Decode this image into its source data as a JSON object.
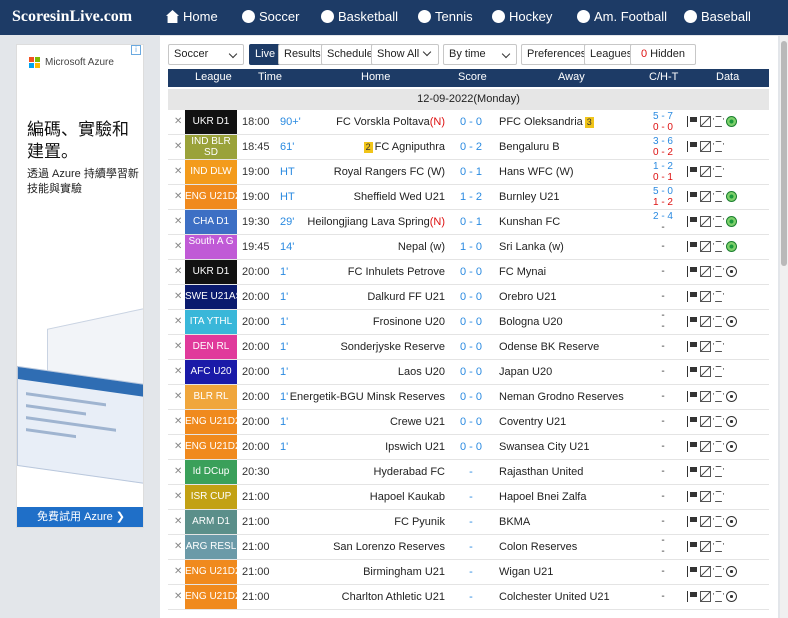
{
  "logo": "ScoresinLive.com",
  "nav": [
    {
      "label": "Home",
      "icon": "house-icon"
    },
    {
      "label": "Soccer",
      "icon": "soccer-ball-icon"
    },
    {
      "label": "Basketball",
      "icon": "basketball-icon"
    },
    {
      "label": "Tennis",
      "icon": "tennis-ball-icon"
    },
    {
      "label": "Hockey",
      "icon": "hockey-icon"
    },
    {
      "label": "Am. Football",
      "icon": "american-football-icon"
    },
    {
      "label": "Baseball",
      "icon": "baseball-icon"
    }
  ],
  "ad": {
    "brand": "Microsoft Azure",
    "headline": "編碼、實驗和建置。",
    "sub": "透過 Azure 持續學習新技能與實驗",
    "cta": "免費試用 Azure ❯",
    "info_icon": "ad-choices-icon"
  },
  "toolbar": {
    "sport": "Soccer",
    "live": "Live",
    "results": "Results",
    "schedule": "Schedule",
    "show_all": "Show All",
    "by_time": "By time",
    "preferences": "Preferences",
    "leagues": "Leagues",
    "hidden_count": "0",
    "hidden_label": "Hidden"
  },
  "columns": {
    "league": "League",
    "time": "Time",
    "home": "Home",
    "score": "Score",
    "away": "Away",
    "cht": "C/H-T",
    "data": "Data"
  },
  "date": "12-09-2022(Monday)",
  "colors": {
    "nav": "#1d3b66",
    "live_blue": "#2a8ae0",
    "red": "#d11111",
    "card_yellow": "#f0c419"
  },
  "matches": [
    {
      "league": "UKR D1",
      "color": "#111111",
      "time": "18:00",
      "status": "90+'",
      "home": "FC Vorskla Poltava",
      "home_tag": "(N)",
      "home_card": "",
      "score": "0 - 0",
      "away": "PFC Oleksandria",
      "away_card": "3",
      "cht": [
        "5 - 7",
        "0 - 0"
      ],
      "ball": "green"
    },
    {
      "league": "IND BLR SD",
      "color": "#9aa23a",
      "time": "18:45",
      "status": "61'",
      "home": "FC Agniputhra",
      "home_tag": "",
      "home_card": "2",
      "score": "0 - 2",
      "away": "Bengaluru B",
      "away_card": "",
      "cht": [
        "3 - 6",
        "0 - 2"
      ],
      "ball": "none"
    },
    {
      "league": "IND DLW",
      "color": "#f39b1c",
      "time": "19:00",
      "status": "HT",
      "home": "Royal Rangers FC (W)",
      "home_tag": "",
      "home_card": "",
      "score": "0 - 1",
      "away": "Hans WFC (W)",
      "away_card": "",
      "cht": [
        "1 - 2",
        "0 - 1"
      ],
      "ball": "none"
    },
    {
      "league": "ENG U21D2",
      "color": "#f08a1e",
      "time": "19:00",
      "status": "HT",
      "home": "Sheffield Wed U21",
      "home_tag": "",
      "home_card": "",
      "score": "1 - 2",
      "away": "Burnley U21",
      "away_card": "",
      "cht": [
        "5 - 0",
        "1 - 2"
      ],
      "ball": "green"
    },
    {
      "league": "CHA D1",
      "color": "#3d6fc4",
      "time": "19:30",
      "status": "29'",
      "home": "Heilongjiang Lava Spring",
      "home_tag": "(N)",
      "home_card": "",
      "score": "0 - 1",
      "away": "Kunshan FC",
      "away_card": "",
      "cht": [
        "2 - 4",
        "-"
      ],
      "ball": "green"
    },
    {
      "league": "South A G",
      "color": "#c05ad6",
      "time": "19:45",
      "status": "14'",
      "home": "Nepal (w)",
      "home_tag": "",
      "home_card": "",
      "score": "1 - 0",
      "away": "Sri Lanka (w)",
      "away_card": "",
      "cht": [
        "-"
      ],
      "ball": "green"
    },
    {
      "league": "UKR D1",
      "color": "#111111",
      "time": "20:00",
      "status": "1'",
      "home": "FC Inhulets Petrove",
      "home_tag": "",
      "home_card": "",
      "score": "0 - 0",
      "away": "FC Mynai",
      "away_card": "",
      "cht": [
        "-"
      ],
      "ball": "plain"
    },
    {
      "league": "SWE U21AS",
      "color": "#0a1a6e",
      "time": "20:00",
      "status": "1'",
      "home": "Dalkurd FF U21",
      "home_tag": "",
      "home_card": "",
      "score": "0 - 0",
      "away": "Orebro U21",
      "away_card": "",
      "cht": [
        "-"
      ],
      "ball": "none"
    },
    {
      "league": "ITA YTHL",
      "color": "#39b7d9",
      "time": "20:00",
      "status": "1'",
      "home": "Frosinone U20",
      "home_tag": "",
      "home_card": "",
      "score": "0 - 0",
      "away": "Bologna U20",
      "away_card": "",
      "cht": [
        "-",
        "-"
      ],
      "ball": "plain"
    },
    {
      "league": "DEN RL",
      "color": "#e03a9b",
      "time": "20:00",
      "status": "1'",
      "home": "Sonderjyske Reserve",
      "home_tag": "",
      "home_card": "",
      "score": "0 - 0",
      "away": "Odense BK Reserve",
      "away_card": "",
      "cht": [
        "-"
      ],
      "ball": "none"
    },
    {
      "league": "AFC U20",
      "color": "#1a1aa8",
      "time": "20:00",
      "status": "1'",
      "home": "Laos U20",
      "home_tag": "",
      "home_card": "",
      "score": "0 - 0",
      "away": "Japan U20",
      "away_card": "",
      "cht": [
        "-"
      ],
      "ball": "none"
    },
    {
      "league": "BLR RL",
      "color": "#f0a63c",
      "time": "20:00",
      "status": "1'",
      "home": "Energetik-BGU Minsk Reserves",
      "home_tag": "",
      "home_card": "",
      "score": "0 - 0",
      "away": "Neman Grodno Reserves",
      "away_card": "",
      "cht": [
        "-"
      ],
      "ball": "plain"
    },
    {
      "league": "ENG U21D2",
      "color": "#f08a1e",
      "time": "20:00",
      "status": "1'",
      "home": "Crewe U21",
      "home_tag": "",
      "home_card": "",
      "score": "0 - 0",
      "away": "Coventry U21",
      "away_card": "",
      "cht": [
        "-"
      ],
      "ball": "plain"
    },
    {
      "league": "ENG U21D2",
      "color": "#f08a1e",
      "time": "20:00",
      "status": "1'",
      "home": "Ipswich U21",
      "home_tag": "",
      "home_card": "",
      "score": "0 - 0",
      "away": "Swansea City U21",
      "away_card": "",
      "cht": [
        "-"
      ],
      "ball": "plain"
    },
    {
      "league": "Id DCup",
      "color": "#3aa05a",
      "time": "20:30",
      "status": "",
      "home": "Hyderabad FC",
      "home_tag": "",
      "home_card": "",
      "score": "-",
      "away": "Rajasthan United",
      "away_card": "",
      "cht": [
        "-"
      ],
      "ball": "none"
    },
    {
      "league": "ISR CUP",
      "color": "#c2a114",
      "time": "21:00",
      "status": "",
      "home": "Hapoel Kaukab",
      "home_tag": "",
      "home_card": "",
      "score": "-",
      "away": "Hapoel Bnei Zalfa",
      "away_card": "",
      "cht": [
        "-"
      ],
      "ball": "none"
    },
    {
      "league": "ARM D1",
      "color": "#5b8f8a",
      "time": "21:00",
      "status": "",
      "home": "FC Pyunik",
      "home_tag": "",
      "home_card": "",
      "score": "-",
      "away": "BKMA",
      "away_card": "",
      "cht": [
        "-"
      ],
      "ball": "plain"
    },
    {
      "league": "ARG RESL",
      "color": "#6b9aa8",
      "time": "21:00",
      "status": "",
      "home": "San Lorenzo Reserves",
      "home_tag": "",
      "home_card": "",
      "score": "-",
      "away": "Colon Reserves",
      "away_card": "",
      "cht": [
        "-",
        "-"
      ],
      "ball": "none"
    },
    {
      "league": "ENG U21D2",
      "color": "#f08a1e",
      "time": "21:00",
      "status": "",
      "home": "Birmingham U21",
      "home_tag": "",
      "home_card": "",
      "score": "-",
      "away": "Wigan U21",
      "away_card": "",
      "cht": [
        "-"
      ],
      "ball": "plain"
    },
    {
      "league": "ENG U21D2",
      "color": "#f08a1e",
      "time": "21:00",
      "status": "",
      "home": "Charlton Athletic U21",
      "home_tag": "",
      "home_card": "",
      "score": "-",
      "away": "Colchester United U21",
      "away_card": "",
      "cht": [
        "-"
      ],
      "ball": "plain"
    }
  ]
}
